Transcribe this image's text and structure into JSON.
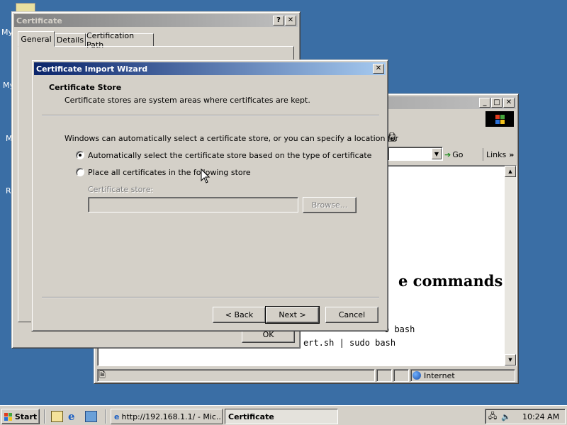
{
  "desktop": {
    "icon_labels": [
      "My",
      "My",
      "M",
      "R"
    ]
  },
  "certificate_window": {
    "title": "Certificate",
    "tabs": [
      {
        "label": "General"
      },
      {
        "label": "Details"
      },
      {
        "label": "Certification Path"
      }
    ],
    "ok_label": "OK"
  },
  "browser_window": {
    "go_label": "Go",
    "links_label": "Links",
    "heading_fragment": "e commands",
    "code_lines": [
      "o bash",
      "ert.sh | sudo bash"
    ],
    "status_zone": "Internet"
  },
  "wizard": {
    "title": "Certificate Import Wizard",
    "header_title": "Certificate Store",
    "header_subtitle": "Certificate stores are system areas where certificates are kept.",
    "intro": "Windows can automatically select a certificate store, or you can specify a location for",
    "option_auto": "Automatically select the certificate store based on the type of certificate",
    "option_manual": "Place all certificates in the following store",
    "store_label": "Certificate store:",
    "store_value": "",
    "browse_label": "Browse...",
    "back_label": "< Back",
    "next_label": "Next >",
    "cancel_label": "Cancel",
    "selected_option": "auto"
  },
  "taskbar": {
    "start_label": "Start",
    "tasks": [
      {
        "label": "http://192.168.1.1/ - Mic..."
      },
      {
        "label": "Certificate"
      }
    ],
    "clock": "10:24 AM"
  }
}
